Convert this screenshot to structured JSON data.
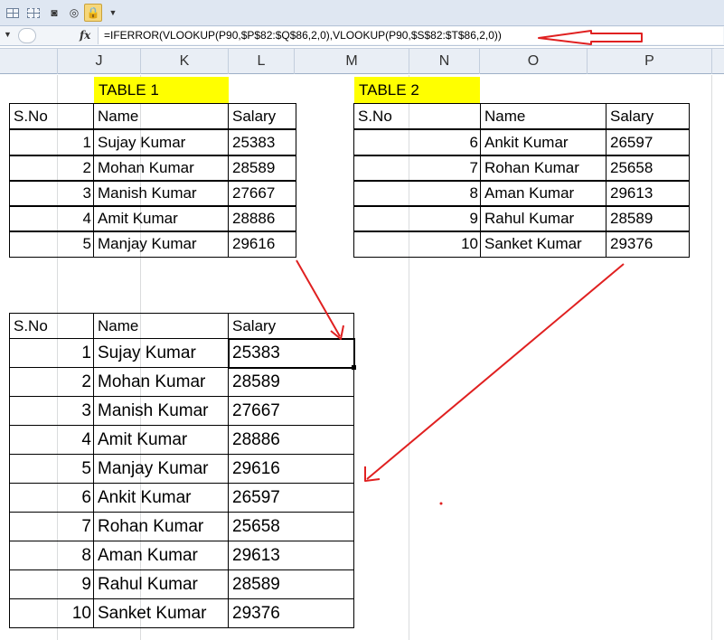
{
  "formula_bar": {
    "formula": "=IFERROR(VLOOKUP(P90,$P$82:$Q$86,2,0),VLOOKUP(P90,$S$82:$T$86,2,0))"
  },
  "columns": [
    "J",
    "K",
    "L",
    "M",
    "N",
    "O",
    "P"
  ],
  "table1": {
    "title": "TABLE 1",
    "headers": [
      "S.No",
      "Name",
      "Salary"
    ],
    "rows": [
      [
        "1",
        "Sujay Kumar",
        "25383"
      ],
      [
        "2",
        "Mohan Kumar",
        "28589"
      ],
      [
        "3",
        "Manish Kumar",
        "27667"
      ],
      [
        "4",
        "Amit Kumar",
        "28886"
      ],
      [
        "5",
        "Manjay Kumar",
        "29616"
      ]
    ]
  },
  "table2": {
    "title": "TABLE 2",
    "headers": [
      "S.No",
      "Name",
      "Salary"
    ],
    "rows": [
      [
        "6",
        "Ankit Kumar",
        "26597"
      ],
      [
        "7",
        "Rohan Kumar",
        "25658"
      ],
      [
        "8",
        "Aman Kumar",
        "29613"
      ],
      [
        "9",
        "Rahul Kumar",
        "28589"
      ],
      [
        "10",
        "Sanket Kumar",
        "29376"
      ]
    ]
  },
  "result": {
    "headers": [
      "S.No",
      "Name",
      "Salary"
    ],
    "rows": [
      [
        "1",
        "Sujay Kumar",
        "25383"
      ],
      [
        "2",
        "Mohan Kumar",
        "28589"
      ],
      [
        "3",
        "Manish Kumar",
        "27667"
      ],
      [
        "4",
        "Amit Kumar",
        "28886"
      ],
      [
        "5",
        "Manjay Kumar",
        "29616"
      ],
      [
        "6",
        "Ankit Kumar",
        "26597"
      ],
      [
        "7",
        "Rohan Kumar",
        "25658"
      ],
      [
        "8",
        "Aman Kumar",
        "29613"
      ],
      [
        "9",
        "Rahul Kumar",
        "28589"
      ],
      [
        "10",
        "Sanket Kumar",
        "29376"
      ]
    ]
  },
  "colors": {
    "highlight": "#ffff00",
    "annotation": "#e02020"
  }
}
